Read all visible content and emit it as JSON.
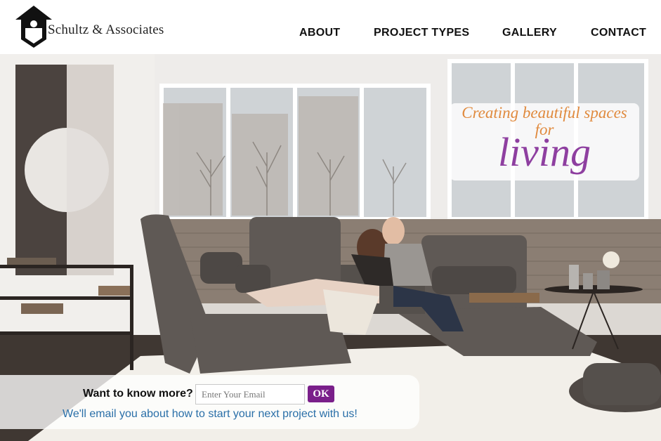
{
  "brand": {
    "name": "Schultz & Associates"
  },
  "nav": {
    "items": [
      "ABOUT",
      "PROJECT TYPES",
      "GALLERY",
      "CONTACT"
    ]
  },
  "hero": {
    "tagline_line1": "Creating beautiful spaces",
    "tagline_line2": "for",
    "tagline_accent": "living"
  },
  "signup": {
    "label": "Want to know more?",
    "email_placeholder": "Enter Your Email",
    "submit_label": "OK",
    "subtext": "We'll email you about how to start your next project with us!"
  },
  "colors": {
    "tagline_orange": "#e08a3e",
    "tagline_purple": "#8e3fa0",
    "button_purple": "#7a1f8a",
    "subtext_blue": "#2a6fa8"
  }
}
